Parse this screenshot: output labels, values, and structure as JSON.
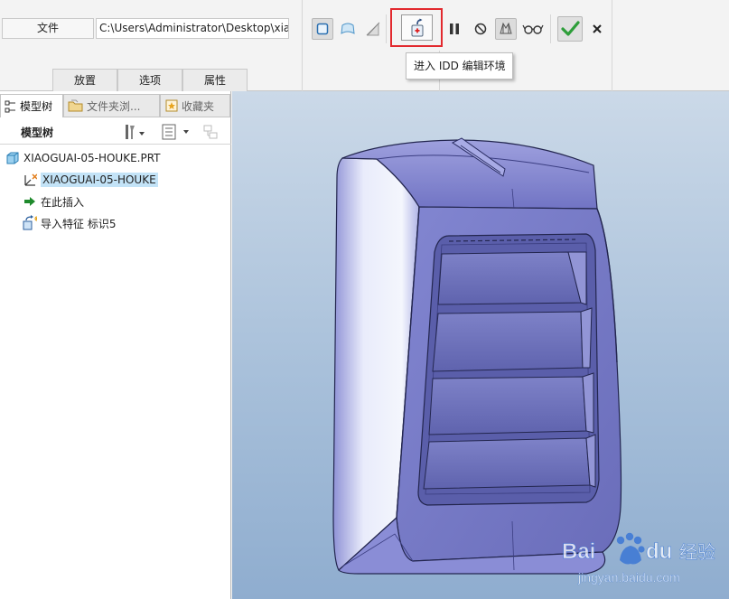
{
  "ribbon": {
    "file_label": "文件",
    "path_value": "C:\\Users\\Administrator\\Desktop\\xia",
    "tabs": [
      "放置",
      "选项",
      "属性"
    ],
    "tooltip": "进入 IDD 编辑环境",
    "highlight_color": "#e2292e",
    "confirm_color": "#2e9e3a"
  },
  "panel": {
    "tabs": [
      "模型树",
      "文件夹浏...",
      "收藏夹"
    ],
    "tree_title": "模型树",
    "items": [
      {
        "label": "XIAOGUAI-05-HOUKE.PRT",
        "icon": "part-icon"
      },
      {
        "label": "XIAOGUAI-05-HOUKE",
        "icon": "csys-icon"
      },
      {
        "label": "在此插入",
        "icon": "insert-arrow-icon"
      },
      {
        "label": "导入特征 标识5",
        "icon": "import-feature-icon"
      }
    ]
  },
  "viewport": {
    "model_color": "#7679c6"
  },
  "watermark": {
    "brand": "Bai",
    "brand2": "du",
    "product": "经验",
    "url": "jingyan.baidu.com"
  }
}
